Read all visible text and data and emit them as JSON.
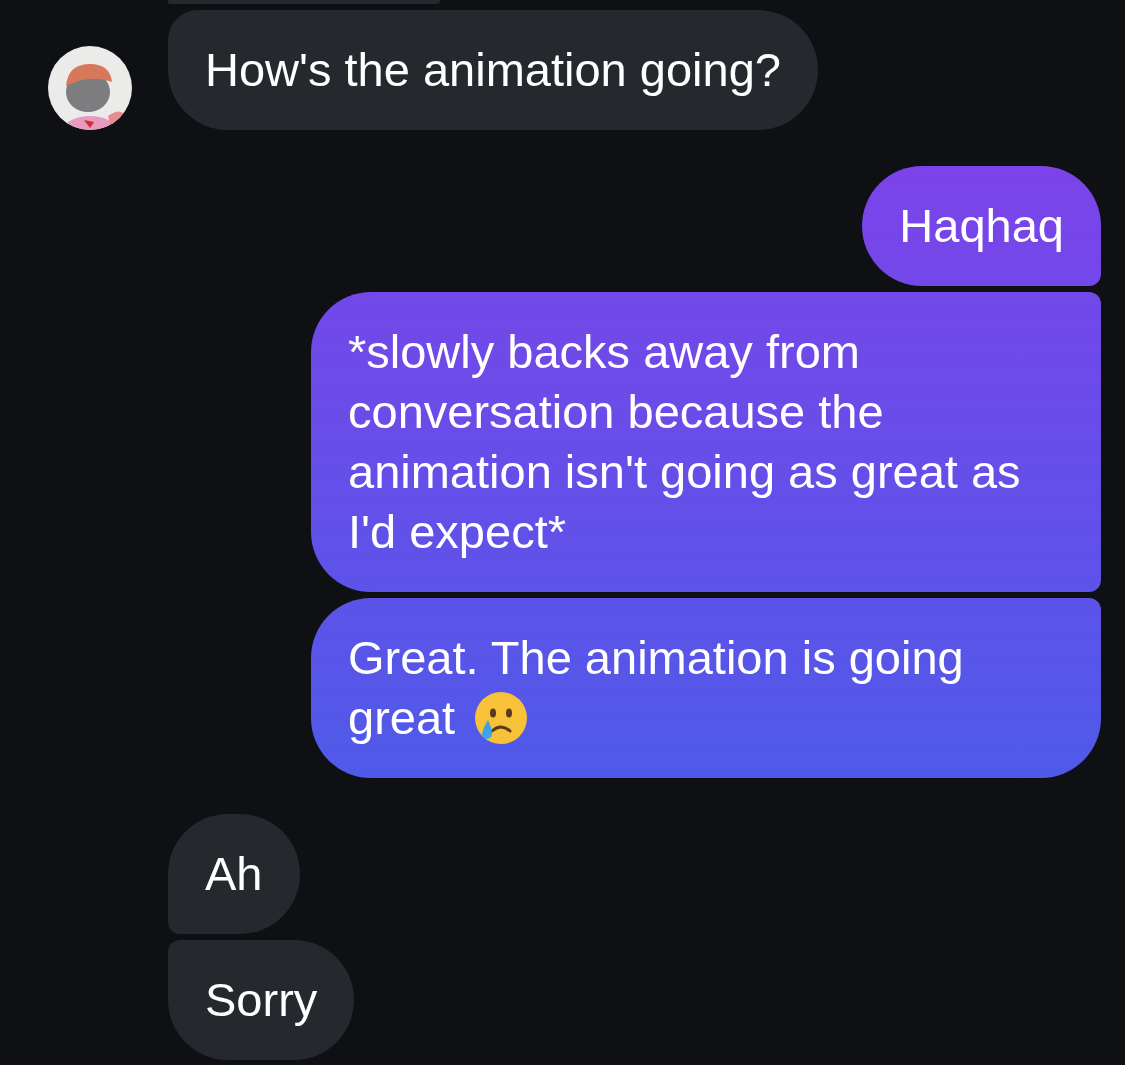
{
  "messages": [
    {
      "kind": "received",
      "text": "How's the animation going?",
      "avatar": true
    },
    {
      "kind": "sent",
      "text": "Haqhaq"
    },
    {
      "kind": "sent",
      "text": "*slowly backs away from conversation because the animation isn't going as great as I'd expect*"
    },
    {
      "kind": "sent",
      "text": "Great. The animation is going great",
      "emoji": true
    },
    {
      "kind": "received",
      "text": "Ah"
    },
    {
      "kind": "received",
      "text": "Sorry"
    }
  ]
}
